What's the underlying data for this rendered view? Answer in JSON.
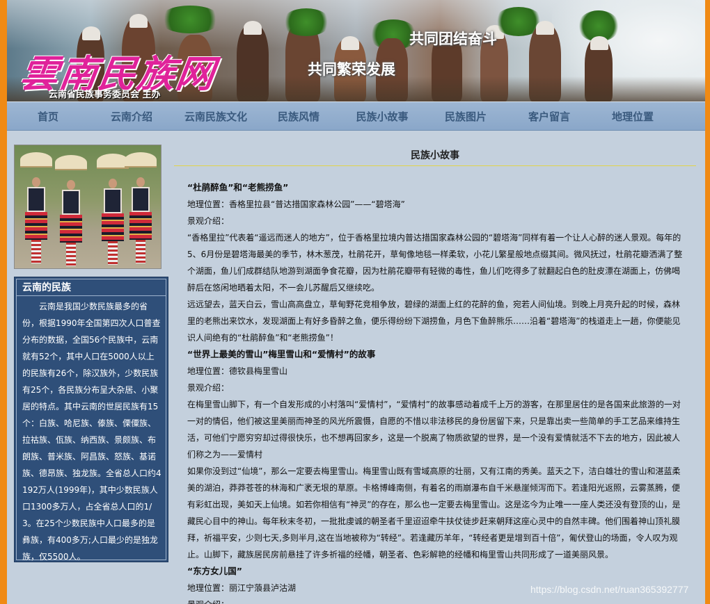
{
  "banner": {
    "logo_text": "雲南民族网",
    "sponsor": "云南省民族事务委员会  主办",
    "slogan_1": "共同团结奋斗",
    "slogan_2": "共同繁荣发展"
  },
  "nav": {
    "items": [
      "首页",
      "云南介绍",
      "云南民族文化",
      "民族风情",
      "民族小故事",
      "民族图片",
      "客户留言",
      "地理位置"
    ]
  },
  "sidebar": {
    "box_title": "云南的民族",
    "box_text": "云南是我国少数民族最多的省份，根据1990年全国第四次人口普查分布的数据，全国56个民族中，云南就有52个，其中人口在5000人以上的民族有26个，除汉族外，少数民族有25个，各民族分布呈大杂居、小聚居的特点。其中云南的世居民族有15个：白族、哈尼族、傣族、傈僳族、拉祜族、佤族、纳西族、景颇族、布朗族、普米族、阿昌族、怒族、基诺族、德昂族、独龙族。全省总人口约4192万人(1999年)，其中少数民族人口1300多万人，占全省总人口的1/3。在25个少数民族中人口最多的是彝族，有400多万;人口最少的是独龙族，仅5500人。"
  },
  "main": {
    "title": "民族小故事",
    "paragraphs": [
      {
        "text": "“杜鹃醉鱼”和“老熊捞鱼”",
        "bold": true
      },
      {
        "text": "地理位置：香格里拉县“普达措国家森林公园”——“碧塔海”",
        "bold": false
      },
      {
        "text": "景观介绍：",
        "bold": false
      },
      {
        "text": "“香格里拉”代表着“遥远而迷人的地方”，位于香格里拉境内普达措国家森林公园的“碧塔海”同样有着一个让人心醉的迷人景观。每年的5、6月份是碧塔海最美的季节，林木葱茂，杜鹃花开，草甸像地毯一样柔软，小花儿繁星般地点缀其间。微风抚过，杜鹃花瓣洒满了整个湖面，鱼儿们成群结队地游到湖面争食花瓣，因为杜鹃花瓣带有轻微的毒性，鱼儿们吃得多了就翻起白色的肚皮漂在湖面上，仿佛喝醉后在悠闲地晒着太阳，不一会儿苏醒后又继续吃。",
        "bold": false
      },
      {
        "text": "远远望去，蓝天白云，雪山高高盘立，草甸野花竞相争放，碧绿的湖面上红的花醉的鱼，宛若人间仙境。到晚上月亮升起的时候，森林里的老熊出来饮水，发现湖面上有好多昏醉之鱼，便乐得纷纷下湖捞鱼，月色下鱼醉熊乐……沿着“碧塔海”的栈道走上一趟，你便能见识人间绝有的“杜鹃醉鱼”和“老熊捞鱼”！",
        "bold": false
      },
      {
        "text": "“世界上最美的雪山”梅里雪山和“爱情村”的故事",
        "bold": true
      },
      {
        "text": "地理位置：德钦县梅里雪山",
        "bold": false
      },
      {
        "text": "景观介绍：",
        "bold": false
      },
      {
        "text": "在梅里雪山脚下，有一个自发形成的小村落叫“爱情村”，“爱情村”的故事感动着成千上万的游客，在那里居住的是各国来此旅游的一对一对的情侣，他们被这里美丽而神圣的风光所震慑，自愿的不惜以非法移民的身份居留下来，只是靠出卖一些简单的手工艺品来维持生活，可他们宁愿穷穷却过得很快乐，也不想再回家乡，这是一个脱离了物质欲望的世界，是一个没有爱情就活不下去的地方，因此被人们称之为——爱情村",
        "bold": false
      },
      {
        "text": "如果你没到过“仙境”，那么一定要去梅里雪山。梅里雪山既有雪域高原的壮丽，又有江南的秀美。蓝天之下，洁白雄壮的雪山和湛蓝柔美的湖泊，莽莽苍苍的林海和广袤无垠的草原。卡格博峰南侧，有着名的雨崩瀑布自千米悬崖倾泻而下。若逢阳光返照，云雾蒸腾，便有彩虹出现，美如天上仙境。如若你相信有“神灵”的存在，那么也一定要去梅里雪山。这是迄今为止唯一一座人类还没有登顶的山，是藏民心目中的神山。每年秋末冬初，一批批虔诚的朝圣者千里迢迢牵牛扶仗徒步赶来朝拜这座心灵中的自然丰碑。他们围着神山顶礼膜拜，祈福平安，少则七天,多则半月,这在当地被称为“转经”。若逢藏历羊年，“转经者更是增到百十倍”，匍伏登山的场面，令人叹为观止。山脚下，藏族居民房前悬挂了许多祈福的经幡，朝圣者、色彩解艳的经幡和梅里雪山共同形成了一道美丽风景。",
        "bold": false
      },
      {
        "text": "“东方女儿国”",
        "bold": true
      },
      {
        "text": "地理位置：丽江宁蒗县泸沽湖",
        "bold": false
      },
      {
        "text": "景观介绍：",
        "bold": false
      }
    ]
  },
  "watermark": "https://blog.csdn.net/ruan365392777"
}
